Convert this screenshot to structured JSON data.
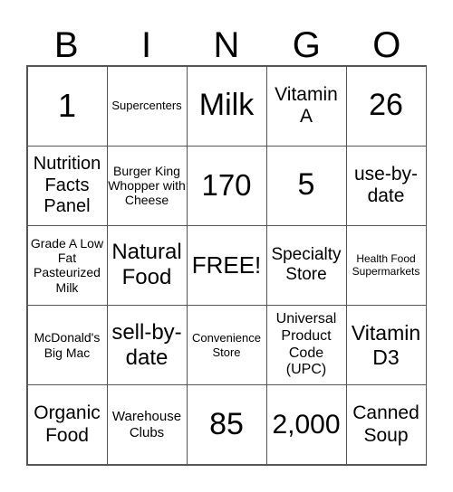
{
  "header": {
    "letters": [
      "B",
      "I",
      "N",
      "G",
      "O"
    ]
  },
  "cells": [
    "1",
    "Supercenters",
    "Milk",
    "Vitamin A",
    "26",
    "Nutrition Facts Panel",
    "Burger King Whopper with Cheese",
    "170",
    "5",
    "use-by-date",
    "Grade A Low Fat Pasteurized Milk",
    "Natural Food",
    "FREE!",
    "Specialty Store",
    "Health Food Supermarkets",
    "McDonald's Big Mac",
    "sell-by-date",
    "Convenience Store",
    "Universal Product Code (UPC)",
    "Vitamin D3",
    "Organic Food",
    "Warehouse Clubs",
    "85",
    "2,000",
    "Canned Soup"
  ]
}
